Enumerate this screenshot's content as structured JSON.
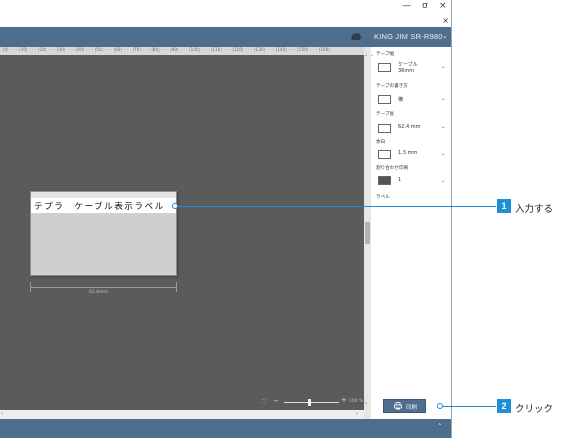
{
  "window": {
    "controls": {
      "minimize": "—",
      "maximize": "ơ",
      "close": "×",
      "secondary_close": "×"
    }
  },
  "header": {
    "printer_name": "KING JIM SR-R980",
    "printer_dropdown": "⌄"
  },
  "ruler": {
    "ticks": "|0¦ · · · |10¦ · · · |20¦ · · · |30¦ · · · |40¦ · · · |50¦ · · · |60¦ · · · |70¦ · · · |80¦ · · · |90¦ · · · |100¦ · · · |110¦ · · · |120¦ · · · |130¦ · · · |140¦ · · · |150¦ · · · |160¦"
  },
  "canvas": {
    "label_text": "テプラ　ケーブル表示ラベル",
    "dimension_text": "62.4mm",
    "zoom": {
      "fit": "⛶",
      "minus": "−",
      "plus": "+",
      "percent": "100 %"
    },
    "zoom_level": 0.45
  },
  "scrollbars": {
    "up": "˄",
    "down": "˅",
    "left": "‹",
    "right": "›"
  },
  "properties": {
    "tape_width": {
      "label": "テープ幅",
      "value_line1": "ケーブル",
      "value_line2": "36mm",
      "chevron": "⌄"
    },
    "tape_orientation": {
      "label": "テープの書き方",
      "value": "横",
      "chevron": "⌄"
    },
    "tape_length": {
      "label": "テープ長",
      "value": "62.4 mm",
      "chevron": "⌄"
    },
    "margin": {
      "label": "余白",
      "value": "1.3 mm",
      "chevron": "⌄"
    },
    "print_copies": {
      "label": "割り合わせ印刷",
      "value": "1",
      "chevron": "⌄"
    },
    "label_section": {
      "label": "ラベル"
    }
  },
  "print_button": {
    "label": "印刷"
  },
  "statusbar": {
    "chevron": "˄"
  },
  "callouts": [
    {
      "number": "1",
      "text": "入力する"
    },
    {
      "number": "2",
      "text": "クリック"
    }
  ],
  "colors": {
    "accent": "#4f6e8e",
    "canvas": "#5b5b5b",
    "callout": "#1d8fd6"
  }
}
